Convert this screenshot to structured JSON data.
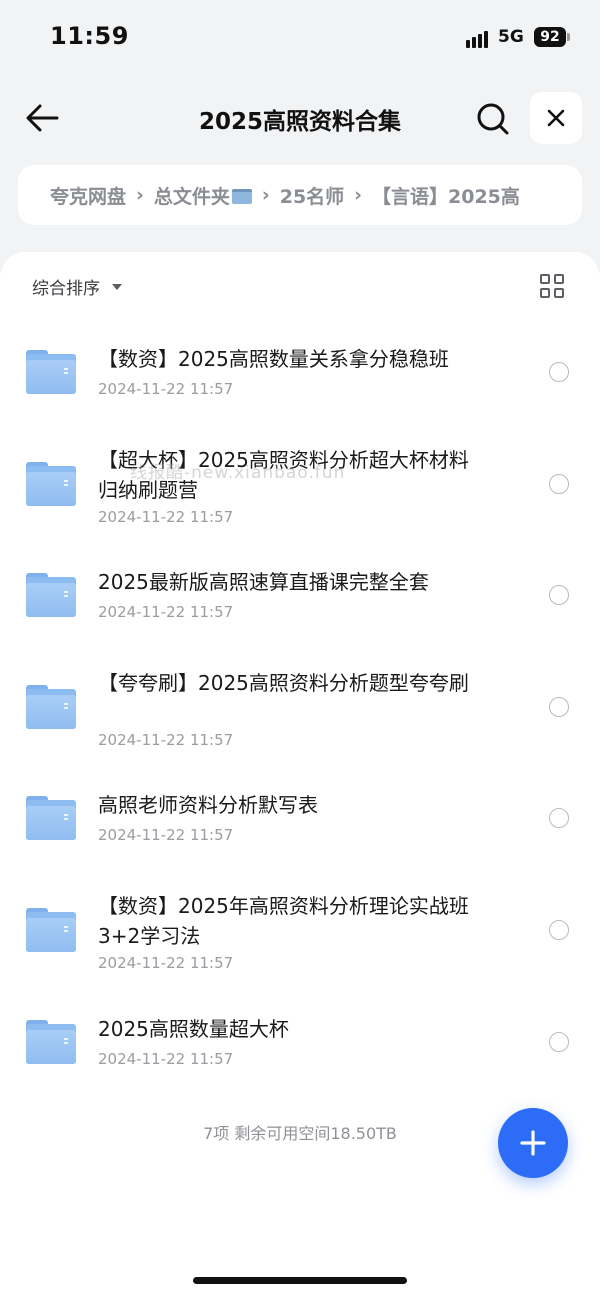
{
  "status_bar": {
    "time": "11:59",
    "network": "5G",
    "battery": "92"
  },
  "header": {
    "title": "2025高照资料合集"
  },
  "breadcrumb": [
    "夸克网盘",
    "总文件夹",
    "25名师",
    "【言语】2025高"
  ],
  "toolbar": {
    "sort_label": "综合排序"
  },
  "files": [
    {
      "name": "【数资】2025高照数量关系拿分稳稳班",
      "date": "2024-11-22 11:57"
    },
    {
      "name": "【超大杯】2025高照资料分析超大杯材料归纳刷题营",
      "date": "2024-11-22 11:57"
    },
    {
      "name": "2025最新版高照速算直播课完整全套",
      "date": "2024-11-22 11:57"
    },
    {
      "name": "【夸夸刷】2025高照资料分析题型夸夸刷",
      "date": "2024-11-22 11:57"
    },
    {
      "name": "高照老师资料分析默写表",
      "date": "2024-11-22 11:57"
    },
    {
      "name": "【数资】2025年高照资料分析理论实战班3+2学习法",
      "date": "2024-11-22 11:57"
    },
    {
      "name": "2025高照数量超大杯",
      "date": "2024-11-22 11:57"
    }
  ],
  "footer": {
    "info": "7项 剩余可用空间18.50TB"
  },
  "watermark": "线报酷-new.xianbao.fun",
  "icons": {
    "back": "arrow-left-icon",
    "search": "search-icon",
    "close": "close-icon",
    "grid": "grid-view-icon",
    "folder": "folder-icon",
    "add": "plus-icon"
  },
  "colors": {
    "accent": "#2c6cf6",
    "folder": "#8fbdf1",
    "background": "#f2f3f5"
  }
}
